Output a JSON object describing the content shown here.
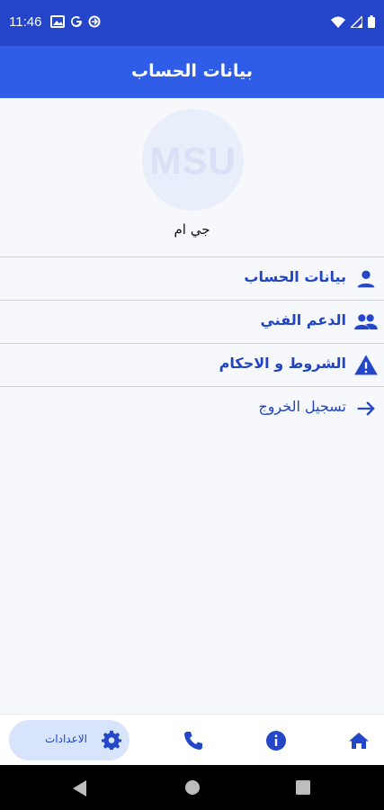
{
  "status_bar": {
    "time": "11:46"
  },
  "app_bar": {
    "title": "بيانات الحساب"
  },
  "profile": {
    "avatar_text": "MSU",
    "name": "جي ام"
  },
  "menu": [
    {
      "label": "بيانات الحساب",
      "icon": "person-icon"
    },
    {
      "label": "الدعم الفني",
      "icon": "people-icon"
    },
    {
      "label": "الشروط و الاحكام",
      "icon": "warning-icon"
    },
    {
      "label": "تسجيل الخروج",
      "icon": "arrow-right-icon"
    }
  ],
  "bottom_nav": {
    "settings_label": "الاعدادات",
    "items": [
      "gear-icon",
      "phone-icon",
      "info-icon",
      "home-icon"
    ]
  },
  "colors": {
    "primary": "#2f5de8",
    "status": "#2445c9",
    "accent_text": "#1f44c8",
    "pill": "#d7e4fb"
  }
}
